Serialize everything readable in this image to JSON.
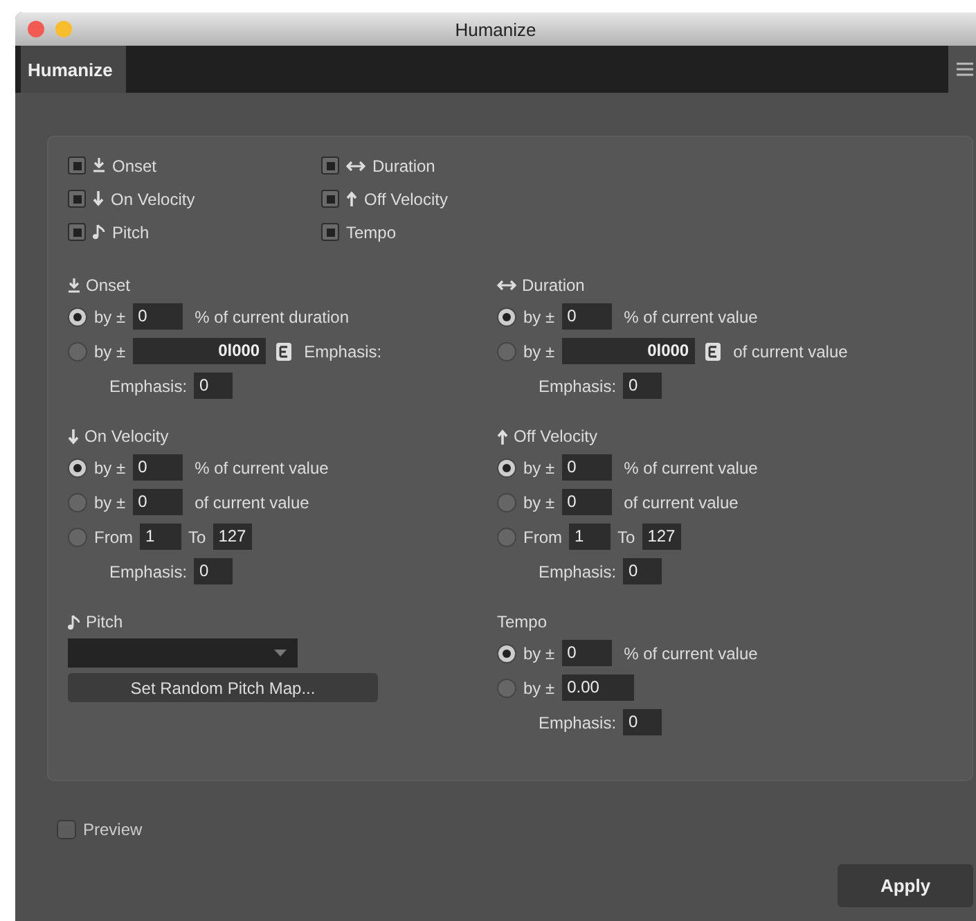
{
  "window": {
    "title": "Humanize"
  },
  "tabs": [
    {
      "label": "Humanize",
      "selected": true
    }
  ],
  "toggles": [
    {
      "label": "Onset",
      "kind": "onset",
      "checked": true
    },
    {
      "label": "Duration",
      "kind": "duration",
      "checked": true
    },
    {
      "label": "On Velocity",
      "kind": "on-velocity",
      "checked": true
    },
    {
      "label": "Off Velocity",
      "kind": "off-velocity",
      "checked": true
    },
    {
      "label": "Pitch",
      "kind": "pitch",
      "checked": true
    },
    {
      "label": "Tempo",
      "kind": "plain",
      "checked": true
    }
  ],
  "sections": [
    {
      "title": "Onset",
      "kind": "onset",
      "rows": [
        {
          "kind": "option",
          "selected": true,
          "prefix": "by ±",
          "value": "0",
          "suffix": "% of current duration"
        },
        {
          "kind": "option-wide",
          "selected": false,
          "prefix": "by ±",
          "value": "0l000",
          "suffix": "Emphasis:"
        },
        {
          "kind": "emphasis",
          "label": "Emphasis:",
          "value": "0"
        }
      ]
    },
    {
      "title": "Duration",
      "kind": "duration",
      "rows": [
        {
          "kind": "option",
          "selected": true,
          "prefix": "by ±",
          "value": "0",
          "suffix": "% of current value"
        },
        {
          "kind": "option-wide",
          "selected": false,
          "prefix": "by ±",
          "value": "0l000",
          "suffix": "of current value"
        },
        {
          "kind": "emphasis",
          "label": "Emphasis:",
          "value": "0"
        }
      ]
    },
    {
      "title": "On Velocity",
      "kind": "on-velocity",
      "rows": [
        {
          "kind": "option",
          "selected": true,
          "prefix": "by ±",
          "value": "0",
          "suffix": "% of current value"
        },
        {
          "kind": "option",
          "selected": false,
          "prefix": "by ±",
          "value": "0",
          "suffix": "of current value"
        },
        {
          "kind": "range",
          "selected": false,
          "from_label": "From",
          "from": "1",
          "to_label": "To",
          "to": "127"
        },
        {
          "kind": "emphasis",
          "label": "Emphasis:",
          "value": "0"
        }
      ]
    },
    {
      "title": "Off Velocity",
      "kind": "off-velocity",
      "rows": [
        {
          "kind": "option",
          "selected": true,
          "prefix": "by ±",
          "value": "0",
          "suffix": "% of current value"
        },
        {
          "kind": "option",
          "selected": false,
          "prefix": "by ±",
          "value": "0",
          "suffix": "of current value"
        },
        {
          "kind": "range",
          "selected": false,
          "from_label": "From",
          "from": "1",
          "to_label": "To",
          "to": "127"
        },
        {
          "kind": "emphasis",
          "label": "Emphasis:",
          "value": "0"
        }
      ]
    },
    {
      "title": "Pitch",
      "kind": "pitch",
      "rows": [
        {
          "kind": "dropdown"
        },
        {
          "kind": "button",
          "label": "Set Random Pitch Map..."
        }
      ]
    },
    {
      "title": "Tempo",
      "kind": "plain",
      "rows": [
        {
          "kind": "option",
          "selected": true,
          "prefix": "by ±",
          "value": "0",
          "suffix": "% of current value"
        },
        {
          "kind": "option-mid",
          "selected": false,
          "prefix": "by ±",
          "value": "0.00"
        },
        {
          "kind": "emphasis",
          "label": "Emphasis:",
          "value": "0"
        }
      ]
    }
  ],
  "preview": {
    "label": "Preview",
    "checked": false
  },
  "apply": {
    "label": "Apply"
  }
}
